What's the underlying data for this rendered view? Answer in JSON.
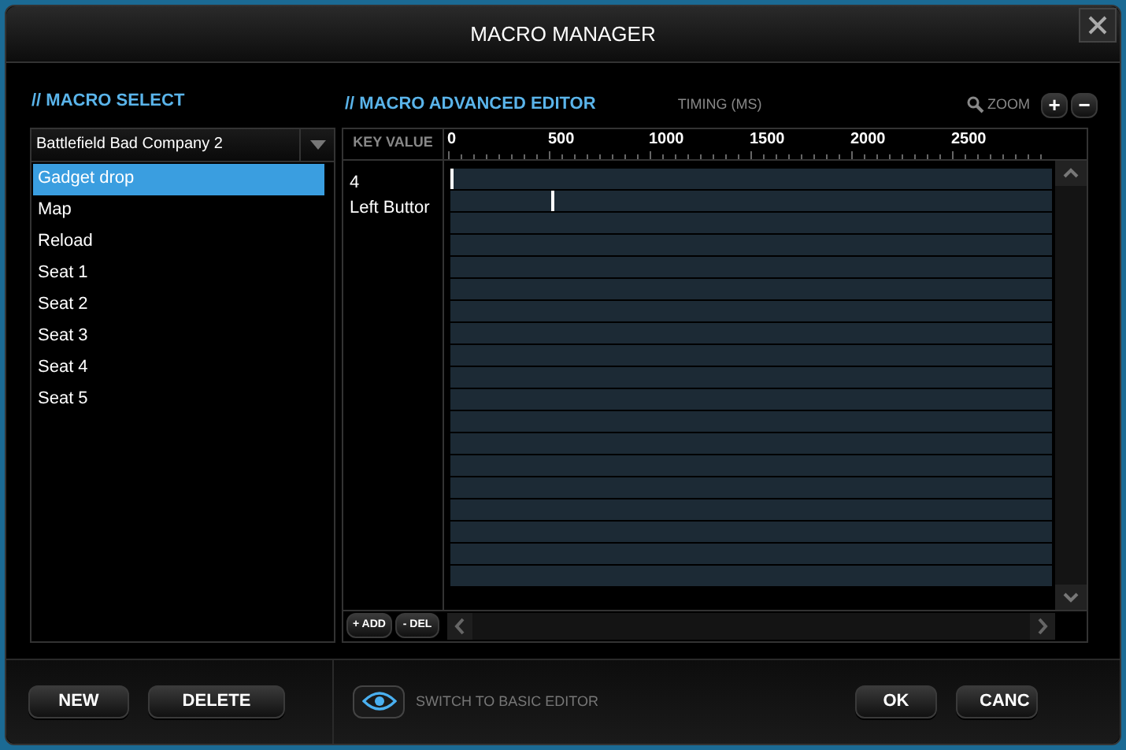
{
  "window": {
    "title": "MACRO MANAGER"
  },
  "macro_select": {
    "heading": "// MACRO SELECT",
    "dropdown": {
      "value": "Battlefield Bad Company 2"
    },
    "items": [
      {
        "label": "Gadget drop",
        "selected": true
      },
      {
        "label": "Map",
        "selected": false
      },
      {
        "label": "Reload",
        "selected": false
      },
      {
        "label": "Seat 1",
        "selected": false
      },
      {
        "label": "Seat 2",
        "selected": false
      },
      {
        "label": "Seat 3",
        "selected": false
      },
      {
        "label": "Seat 4",
        "selected": false
      },
      {
        "label": "Seat 5",
        "selected": false
      }
    ]
  },
  "editor": {
    "heading": "// MACRO ADVANCED EDITOR",
    "timing_label": "TIMING (MS)",
    "zoom_label": "ZOOM",
    "zoom_in": "+",
    "zoom_out": "−",
    "key_value_header": "KEY VALUE",
    "ticks": [
      "0",
      "500",
      "1000",
      "1500",
      "2000",
      "2500"
    ],
    "keys": [
      {
        "code": "4",
        "name": "Left Buttor"
      }
    ],
    "lanes": [
      {
        "marker": true,
        "level": 0
      },
      {
        "marker": true,
        "level": 0.168
      },
      {
        "marker": false
      },
      {
        "marker": false
      },
      {
        "marker": false
      },
      {
        "marker": false
      },
      {
        "marker": false
      },
      {
        "marker": false
      },
      {
        "marker": false
      },
      {
        "marker": false
      },
      {
        "marker": false
      },
      {
        "marker": false
      },
      {
        "marker": false
      },
      {
        "marker": false
      },
      {
        "marker": false
      },
      {
        "marker": false
      },
      {
        "marker": false
      },
      {
        "marker": false
      },
      {
        "marker": false
      }
    ],
    "add_button": "+ ADD",
    "del_button": "- DEL"
  },
  "footer": {
    "new_button": "NEW",
    "delete_button": "DELETE",
    "switch_label": "SWITCH TO BASIC EDITOR",
    "ok_button": "OK",
    "cancel_button": "CANC"
  }
}
